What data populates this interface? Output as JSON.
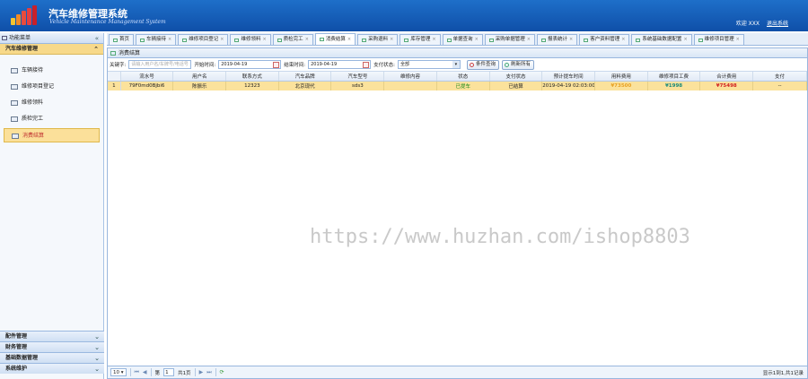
{
  "app": {
    "title": "汽车维修管理系统",
    "subtitle": "Vehicle Maintenance Management System",
    "welcome": "欢迎 XXX",
    "logout": "退出系统"
  },
  "sidebar": {
    "header": "功能菜单",
    "open_group": "汽车维修管理",
    "items": [
      {
        "label": "车辆接待"
      },
      {
        "label": "维修项目登记"
      },
      {
        "label": "维修领料"
      },
      {
        "label": "质检完工"
      },
      {
        "label": "消费结算"
      }
    ],
    "closed_groups": [
      "配件管理",
      "财务管理",
      "基础数据管理",
      "系统维护"
    ]
  },
  "tabs": [
    {
      "label": "首页"
    },
    {
      "label": "车辆接待"
    },
    {
      "label": "维修项目登记"
    },
    {
      "label": "维修领料"
    },
    {
      "label": "质检完工"
    },
    {
      "label": "消费结算"
    },
    {
      "label": "采购退料"
    },
    {
      "label": "库存管理"
    },
    {
      "label": "单据查询"
    },
    {
      "label": "采购单据管理"
    },
    {
      "label": "报表统计"
    },
    {
      "label": "客户资料管理"
    },
    {
      "label": "系统基础数据配置"
    },
    {
      "label": "维修项目管理"
    }
  ],
  "panel": {
    "title": "消费结算"
  },
  "filter": {
    "keyword_label": "关键字:",
    "keyword_placeholder": "请输入用户名/车牌号/电话号",
    "start_label": "开始时间:",
    "start_value": "2019-04-19",
    "end_label": "结束时间:",
    "end_value": "2019-04-19",
    "pay_label": "支付状态:",
    "pay_value": "全部",
    "search_btn": "条件查询",
    "refresh_btn": "刷新所有"
  },
  "table": {
    "columns": [
      "流水号",
      "用户名",
      "联系方式",
      "汽车品牌",
      "汽车型号",
      "维修内容",
      "状态",
      "支付状态",
      "预计提车时间",
      "用料费用",
      "维修项目工费",
      "合计费用",
      "支付"
    ],
    "rows": [
      {
        "num": "1",
        "cells": [
          "79F0md0Bjbi6",
          "陈振乐",
          "12323",
          "北京现代",
          "sds3",
          "",
          "已提车",
          "已结算",
          "2019-04-19 02:03:00",
          "¥73500",
          "¥1998",
          "¥75498",
          "--"
        ]
      }
    ]
  },
  "pager": {
    "page_size": "10",
    "page_prefix": "第",
    "page_value": "1",
    "page_suffix": "共1页",
    "info": "显示1到1,共1记录"
  },
  "watermark": "https://www.huzhan.com/ishop8803"
}
